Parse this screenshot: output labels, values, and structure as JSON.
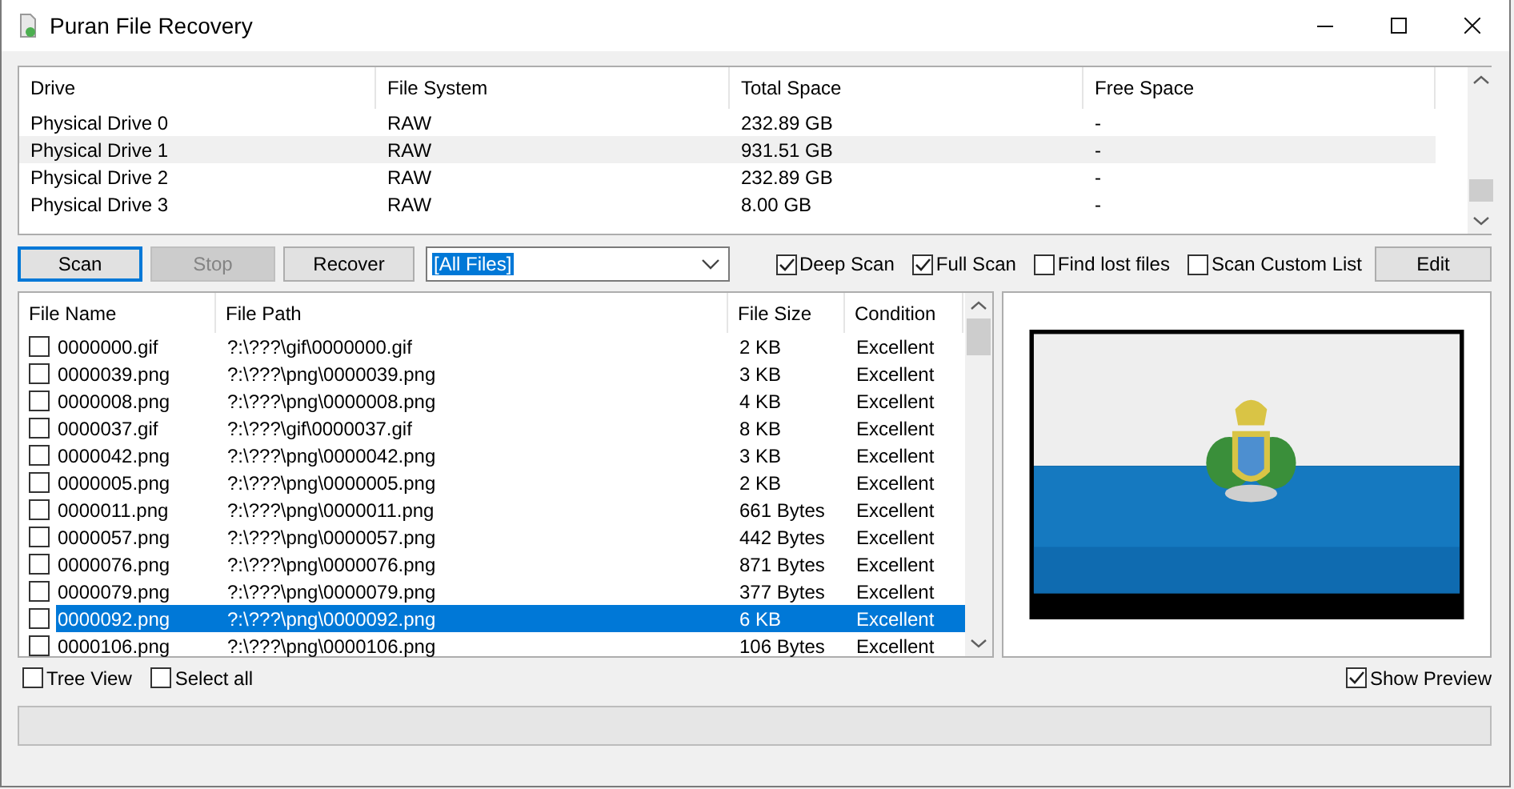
{
  "window": {
    "title": "Puran File Recovery"
  },
  "drives": {
    "columns": [
      "Drive",
      "File System",
      "Total Space",
      "Free Space"
    ],
    "rows": [
      {
        "cells": [
          "Physical Drive 0",
          "RAW",
          "232.89 GB",
          "-"
        ],
        "selected": false
      },
      {
        "cells": [
          "Physical Drive 1",
          "RAW",
          "931.51 GB",
          "-"
        ],
        "selected": true
      },
      {
        "cells": [
          "Physical Drive 2",
          "RAW",
          "232.89 GB",
          "-"
        ],
        "selected": false
      },
      {
        "cells": [
          "Physical Drive 3",
          "RAW",
          "8.00 GB",
          "-"
        ],
        "selected": false
      }
    ]
  },
  "toolbar": {
    "buttons": [
      {
        "label": "Scan",
        "disabled": false,
        "focused": true
      },
      {
        "label": "Stop",
        "disabled": true,
        "focused": false
      },
      {
        "label": "Recover",
        "disabled": false,
        "focused": false
      }
    ],
    "filter": {
      "value": "[All Files]"
    },
    "options": [
      {
        "label": "Deep Scan",
        "checked": true
      },
      {
        "label": "Full Scan",
        "checked": true
      },
      {
        "label": "Find lost files",
        "checked": false
      },
      {
        "label": "Scan Custom List",
        "checked": false
      }
    ],
    "edit_button": "Edit"
  },
  "files": {
    "columns": [
      "File Name",
      "File Path",
      "File Size",
      "Condition"
    ],
    "rows": [
      {
        "name": "0000000.gif",
        "path": "?:\\???\\gif\\0000000.gif",
        "size": "2 KB",
        "condition": "Excellent",
        "checked": false,
        "selected": false
      },
      {
        "name": "0000039.png",
        "path": "?:\\???\\png\\0000039.png",
        "size": "3 KB",
        "condition": "Excellent",
        "checked": false,
        "selected": false
      },
      {
        "name": "0000008.png",
        "path": "?:\\???\\png\\0000008.png",
        "size": "4 KB",
        "condition": "Excellent",
        "checked": false,
        "selected": false
      },
      {
        "name": "0000037.gif",
        "path": "?:\\???\\gif\\0000037.gif",
        "size": "8 KB",
        "condition": "Excellent",
        "checked": false,
        "selected": false
      },
      {
        "name": "0000042.png",
        "path": "?:\\???\\png\\0000042.png",
        "size": "3 KB",
        "condition": "Excellent",
        "checked": false,
        "selected": false
      },
      {
        "name": "0000005.png",
        "path": "?:\\???\\png\\0000005.png",
        "size": "2 KB",
        "condition": "Excellent",
        "checked": false,
        "selected": false
      },
      {
        "name": "0000011.png",
        "path": "?:\\???\\png\\0000011.png",
        "size": "661 Bytes",
        "condition": "Excellent",
        "checked": false,
        "selected": false
      },
      {
        "name": "0000057.png",
        "path": "?:\\???\\png\\0000057.png",
        "size": "442 Bytes",
        "condition": "Excellent",
        "checked": false,
        "selected": false
      },
      {
        "name": "0000076.png",
        "path": "?:\\???\\png\\0000076.png",
        "size": "871 Bytes",
        "condition": "Excellent",
        "checked": false,
        "selected": false
      },
      {
        "name": "0000079.png",
        "path": "?:\\???\\png\\0000079.png",
        "size": "377 Bytes",
        "condition": "Excellent",
        "checked": false,
        "selected": false
      },
      {
        "name": "0000092.png",
        "path": "?:\\???\\png\\0000092.png",
        "size": "6 KB",
        "condition": "Excellent",
        "checked": false,
        "selected": true
      },
      {
        "name": "0000106.png",
        "path": "?:\\???\\png\\0000106.png",
        "size": "106 Bytes",
        "condition": "Excellent",
        "checked": false,
        "selected": false
      }
    ]
  },
  "bottom_options": [
    {
      "label": "Tree View",
      "checked": false
    },
    {
      "label": "Select all",
      "checked": false
    }
  ],
  "show_preview": {
    "label": "Show Preview",
    "checked": true
  },
  "progress": {
    "level": 0
  }
}
